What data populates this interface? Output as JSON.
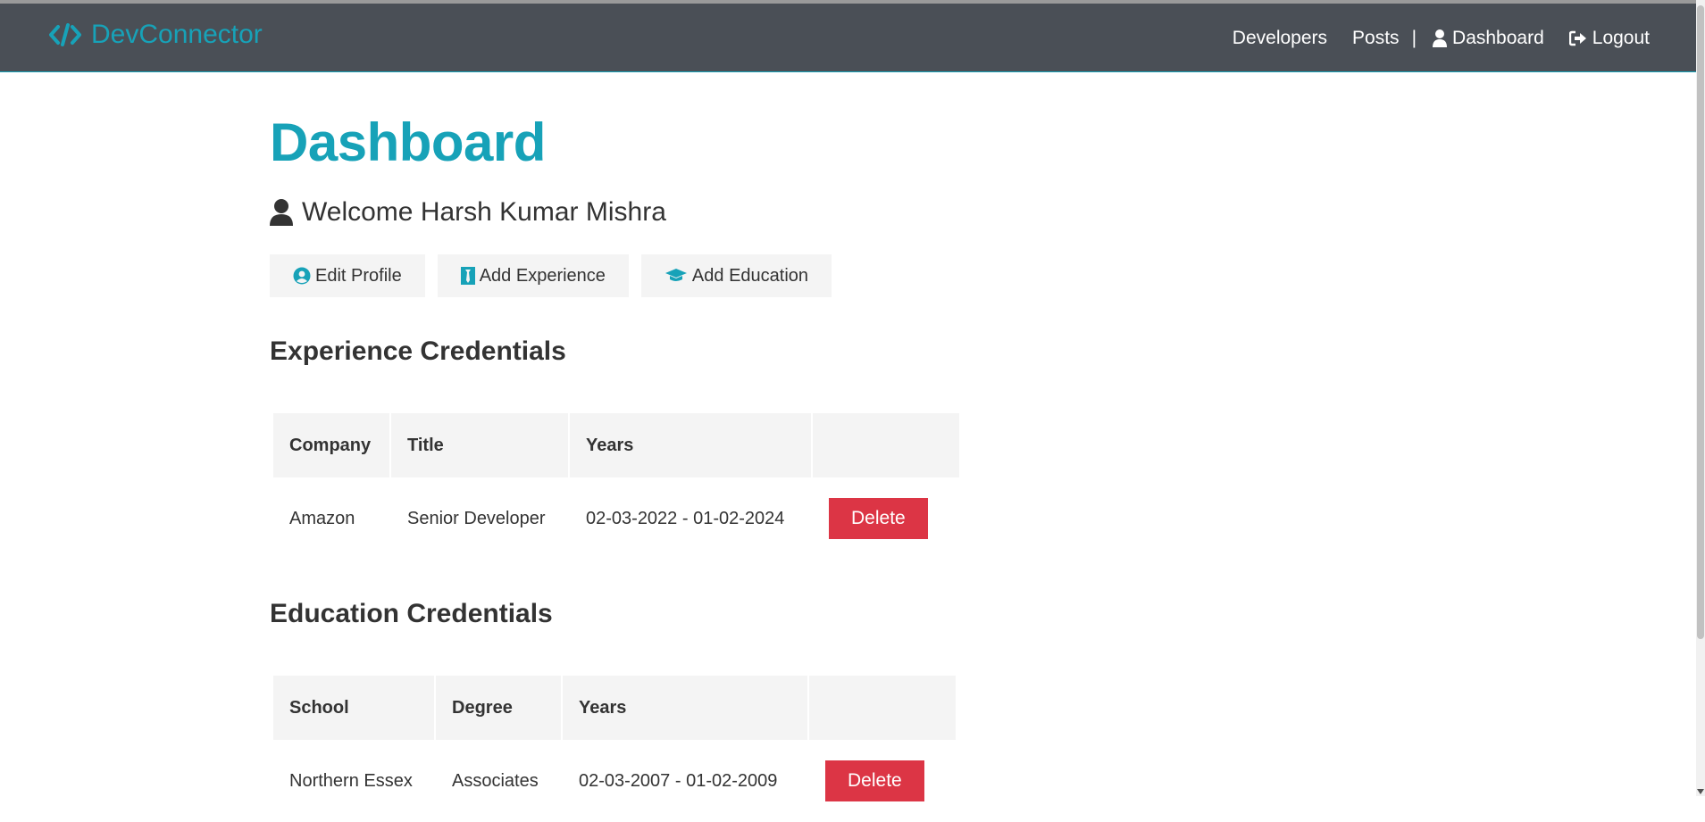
{
  "colors": {
    "accent": "#17a2b8",
    "navbar": "#4a4f56",
    "danger": "#dc3545",
    "light": "#f4f4f4"
  },
  "nav": {
    "brand": "DevConnector",
    "brand_icon": "code-icon",
    "links": [
      "Developers",
      "Posts"
    ],
    "separator": "|",
    "dashboard": "Dashboard",
    "logout": "Logout"
  },
  "page": {
    "title": "Dashboard",
    "welcome": "Welcome Harsh Kumar Mishra"
  },
  "actions": {
    "edit_profile": "Edit Profile",
    "add_experience": "Add Experience",
    "add_education": "Add Education"
  },
  "experience": {
    "title": "Experience Credentials",
    "headers": [
      "Company",
      "Title",
      "Years",
      ""
    ],
    "rows": [
      {
        "company": "Amazon",
        "title": "Senior Developer",
        "years": "02-03-2022 - 01-02-2024",
        "action": "Delete"
      }
    ]
  },
  "education": {
    "title": "Education Credentials",
    "headers": [
      "School",
      "Degree",
      "Years",
      ""
    ],
    "rows": [
      {
        "school": "Northern Essex",
        "degree": "Associates",
        "years": "02-03-2007 - 01-02-2009",
        "action": "Delete"
      }
    ]
  }
}
